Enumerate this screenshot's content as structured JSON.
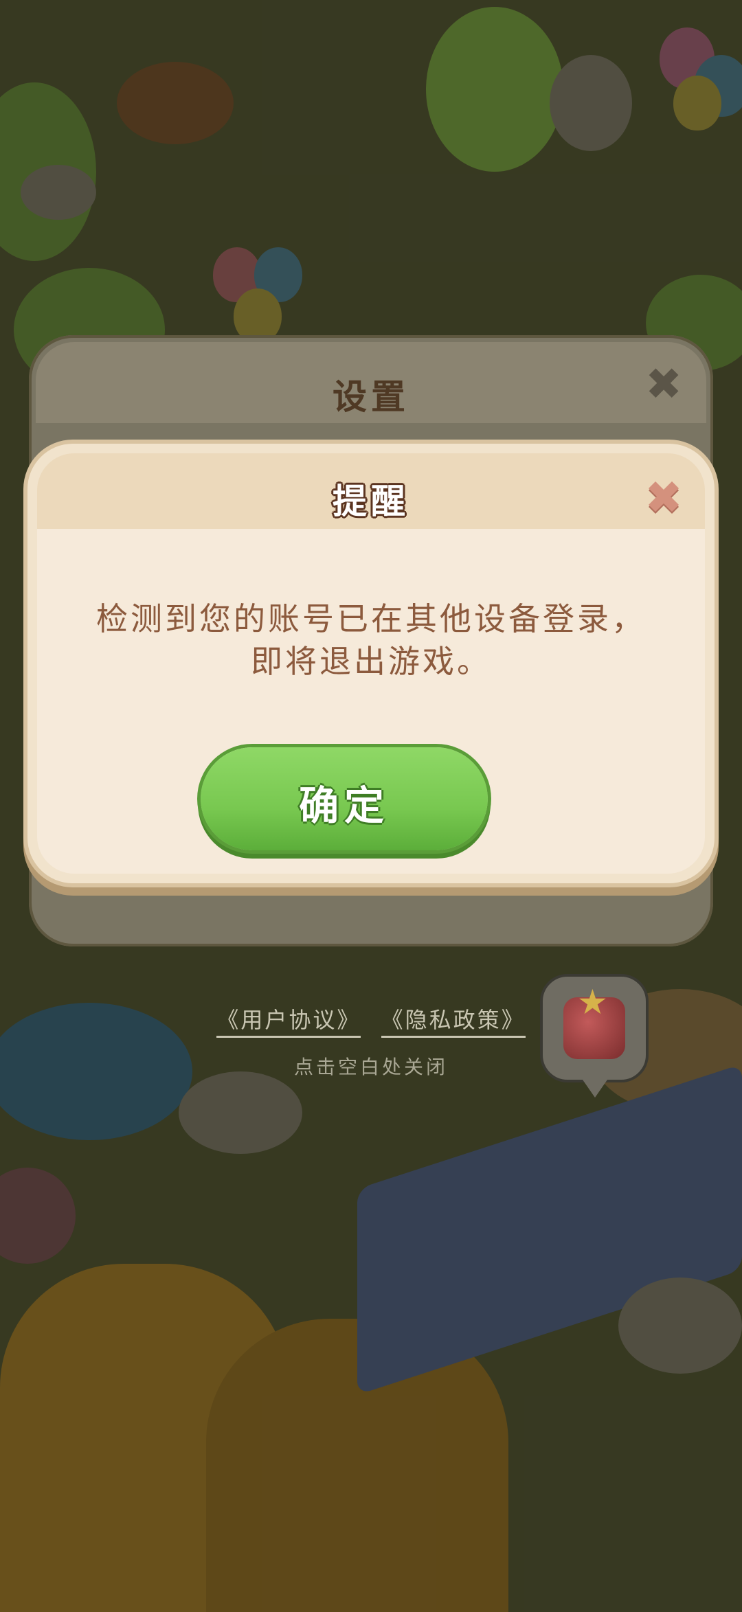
{
  "settings_dialog": {
    "title": "设置",
    "close_glyph": "✖"
  },
  "reminder_dialog": {
    "title": "提醒",
    "close_glyph": "✖",
    "message_line1": "检测到您的账号已在其他设备登录，",
    "message_line2": "即将退出游戏。",
    "confirm_label": "确定"
  },
  "footer": {
    "user_agreement": "《用户协议》",
    "privacy_policy": "《隐私政策》",
    "close_hint": "点击空白处关闭"
  },
  "colors": {
    "confirm_green": "#78c850",
    "dialog_cream": "#f6eada",
    "message_brown": "#8c5a3d",
    "close_pink": "#d4917d"
  },
  "icons": {
    "gift": "gift-icon",
    "star": "star-icon"
  }
}
